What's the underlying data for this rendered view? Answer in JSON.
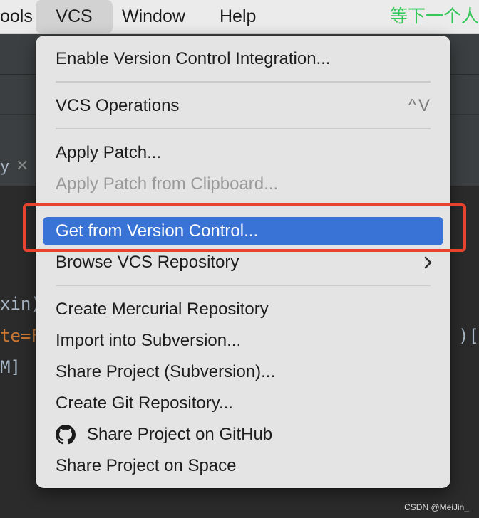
{
  "menubar": {
    "tools": "ools",
    "vcs": "VCS",
    "window": "Window",
    "help": "Help",
    "ime_text": "等下一个人"
  },
  "editor": {
    "tab_fragment": "y",
    "code_line_1": "xin)",
    "code_line_2_a": "te",
    "code_line_2_b": "=F",
    "code_line_3": "M]",
    "code_line_right": ")["
  },
  "menu": {
    "item_enable": "Enable Version Control Integration...",
    "item_vcs_operations": "VCS Operations",
    "item_vcs_operations_shortcut": "^V",
    "item_apply_patch": "Apply Patch...",
    "item_apply_patch_clipboard": "Apply Patch from Clipboard...",
    "item_get_from_vc": "Get from Version Control...",
    "item_browse_repo": "Browse VCS Repository",
    "item_create_mercurial": "Create Mercurial Repository",
    "item_import_svn": "Import into Subversion...",
    "item_share_svn": "Share Project (Subversion)...",
    "item_create_git": "Create Git Repository...",
    "item_share_github": "Share Project on GitHub",
    "item_share_space": "Share Project on Space"
  },
  "icons": {
    "github": "github-icon",
    "submenu": "chevron-right-icon",
    "close": "close-icon"
  },
  "colors": {
    "selection": "#3a73d6",
    "highlight": "#e8432e",
    "ime": "#34c759"
  },
  "watermark": "CSDN @MeiJin_"
}
